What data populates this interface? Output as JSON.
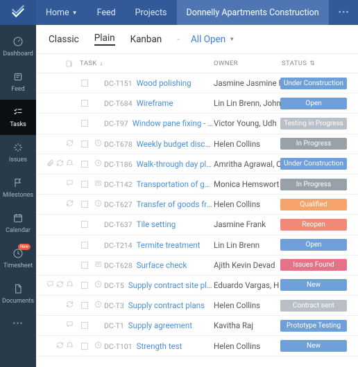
{
  "topnav": {
    "home": "Home",
    "feed": "Feed",
    "projects": "Projects",
    "active": "Donnelly Apartments Construction"
  },
  "rail": {
    "dashboard": "Dashboard",
    "feed": "Feed",
    "tasks": "Tasks",
    "issues": "Issues",
    "milestones": "Milestones",
    "calendar": "Calendar",
    "timesheet": "Timesheet",
    "timesheet_badge": "New",
    "documents": "Documents"
  },
  "views": {
    "classic": "Classic",
    "plain": "Plain",
    "kanban": "Kanban",
    "sep": "-",
    "filter": "All Open"
  },
  "headers": {
    "task": "TASK",
    "owner": "OWNER",
    "status": "STATUS"
  },
  "statuses": {
    "under_construction": "Under Construction",
    "open": "Open",
    "testing_in_progress": "Testing in Progress",
    "in_progress": "In Progress",
    "qualified": "Qualified",
    "reopen": "Reopen",
    "issues_found": "Issues Found",
    "new": "New",
    "contract_sent": "Contract sent",
    "prototype_testing": "Prototype Testing"
  },
  "tasks": [
    {
      "id": "DC-T151",
      "title": "Wood polishing",
      "owner": "Jasmine Jasmine F",
      "status": "under_construction",
      "icons": []
    },
    {
      "id": "DC-T684",
      "title": "Wireframe",
      "owner": "Lin Lin Brenn, John",
      "status": "open",
      "icons": []
    },
    {
      "id": "DC-T97",
      "title": "Window pane fixing - Engine…",
      "owner": "Victor Young, Udh",
      "status": "testing_in_progress",
      "icons": []
    },
    {
      "id": "DC-T678",
      "title": "Weekly budget discussion",
      "owner": "Helen Collins",
      "status": "in_progress",
      "icons": [
        "recur"
      ],
      "sub": "clock"
    },
    {
      "id": "DC-T186",
      "title": "Walk-through day plan",
      "owner": "Amritha Agrawal, O",
      "status": "under_construction",
      "icons": [
        "attach",
        "recur",
        "reminder"
      ],
      "sub": "clock"
    },
    {
      "id": "DC-T142",
      "title": "Transportation of goods",
      "owner": "Monica Hemswort",
      "status": "in_progress",
      "icons": [
        "comment"
      ],
      "sub": "list"
    },
    {
      "id": "DC-T627",
      "title": "Transfer of goods from stor…",
      "owner": "Helen Collins",
      "status": "qualified",
      "icons": [
        "recur"
      ],
      "sub": "clock"
    },
    {
      "id": "DC-T637",
      "title": "Tile setting",
      "owner": "Jasmine Frank",
      "status": "reopen",
      "icons": []
    },
    {
      "id": "DC-T214",
      "title": "Termite treatment",
      "owner": "Lin Lin Brenn",
      "status": "open",
      "icons": []
    },
    {
      "id": "DC-T628",
      "title": "Surface check",
      "owner": "Ajith Kevin Devad",
      "status": "issues_found",
      "icons": [],
      "sub": "list"
    },
    {
      "id": "DC-T5",
      "title": "Supply contract site plan",
      "owner": "Eduardo Vargas, H",
      "status": "new",
      "icons": [
        "comment",
        "recur",
        "reminder"
      ],
      "sub": "clock"
    },
    {
      "id": "DC-T3",
      "title": "Supply contract plans",
      "owner": "Helen Collins",
      "status": "contract_sent",
      "icons": [
        "recur"
      ],
      "sub": "clock"
    },
    {
      "id": "DC-T1",
      "title": "Supply agreement",
      "owner": "Kavitha Raj",
      "status": "prototype_testing",
      "icons": [
        "comment"
      ]
    },
    {
      "id": "DC-T101",
      "title": "Strength test",
      "owner": "Helen Collins",
      "status": "new",
      "icons": [
        "recur",
        "reminder"
      ],
      "sub": "clock"
    }
  ]
}
